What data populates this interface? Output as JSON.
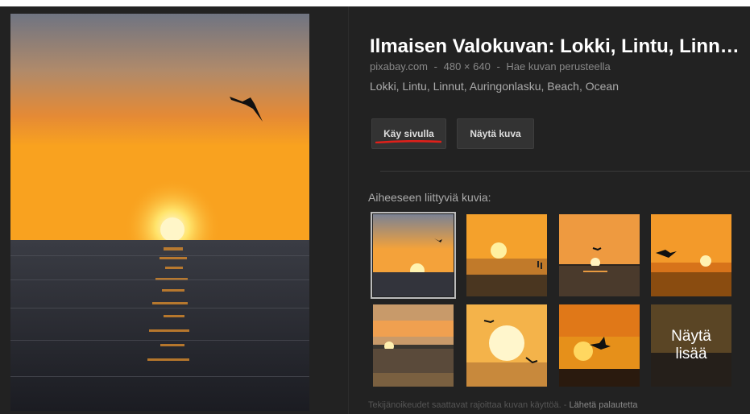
{
  "result": {
    "title": "Ilmaisen Valokuvan: Lokki, Lintu, Linnut, Auringonlasku, Beach, Ocean",
    "source": "pixabay.com",
    "dimensions": "480 × 640",
    "search_by_image": "Hae kuvan perusteella",
    "separator": "-",
    "tags": "Lokki, Lintu, Linnut, Auringonlasku, Beach, Ocean"
  },
  "buttons": {
    "visit": "Käy sivulla",
    "view": "Näytä kuva"
  },
  "related": {
    "heading": "Aiheeseen liittyviä kuvia:",
    "more_line1": "Näytä",
    "more_line2": "lisää"
  },
  "footer": {
    "copyright": "Tekijänoikeudet saattavat rajoittaa kuvan käyttöä.",
    "separator": "-",
    "feedback": "Lähetä palautetta"
  },
  "colors": {
    "background": "#222222",
    "annotation_underline": "#e0201a"
  }
}
